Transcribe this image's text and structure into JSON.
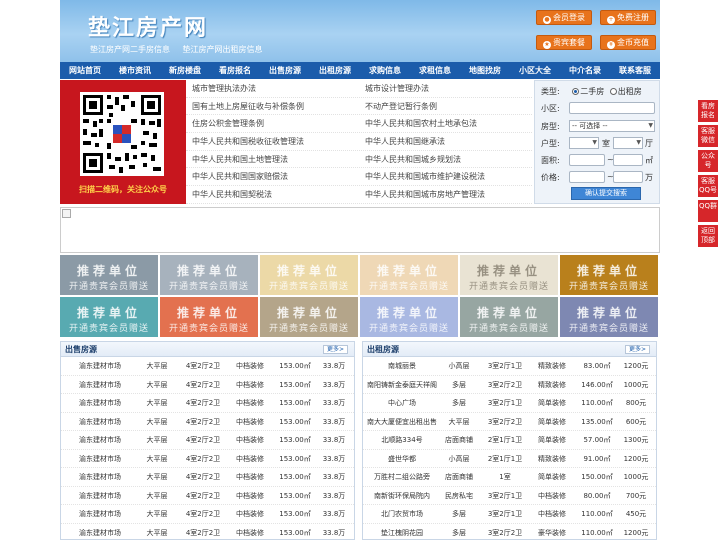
{
  "header": {
    "logo_title": "垫江房产网",
    "subtitles": [
      "垫江房产网二手房信息",
      "垫江房产网出租房信息"
    ],
    "buttons": [
      {
        "label": "会员登录",
        "icon": "user-icon"
      },
      {
        "label": "免费注册",
        "icon": "register-icon"
      },
      {
        "label": "贵宾套餐",
        "icon": "vip-icon"
      },
      {
        "label": "金币充值",
        "icon": "coin-icon"
      }
    ]
  },
  "nav": [
    "网站首页",
    "楼市资讯",
    "新房楼盘",
    "看房报名",
    "出售房源",
    "出租房源",
    "求购信息",
    "求租信息",
    "地图找房",
    "小区大全",
    "中介名录",
    "联系客服"
  ],
  "qr": {
    "caption": "扫描二维码，关注公众号"
  },
  "links": [
    [
      "城市管理执法办法",
      "城市设计管理办法"
    ],
    [
      "国有土地上房屋征收与补偿条例",
      "不动产登记暂行条例"
    ],
    [
      "住房公积金管理条例",
      "中华人民共和国农村土地承包法"
    ],
    [
      "中华人民共和国税收征收管理法",
      "中华人民共和国继承法"
    ],
    [
      "中华人民共和国土地管理法",
      "中华人民共和国城乡规划法"
    ],
    [
      "中华人民共和国国家赔偿法",
      "中华人民共和国城市维护建设税法"
    ],
    [
      "中华人民共和国契税法",
      "中华人民共和国城市房地产管理法"
    ]
  ],
  "search": {
    "type_label": "类型:",
    "radio_sale": "二手房",
    "radio_rent": "出租房",
    "community_label": "小区:",
    "house_type_label": "房型:",
    "house_type_value": "-- 可选择 --",
    "layout_label": "户型:",
    "room_unit": "室",
    "hall_unit": "厅",
    "area_label": "面积:",
    "area_unit": "㎡",
    "price_label": "价格:",
    "price_unit": "万",
    "range_sep": "~",
    "submit": "确认提交搜索"
  },
  "ads": {
    "line1": "推荐单位",
    "line2": "开通贵宾会员赠送",
    "colors": [
      "#8b9aa6",
      "#a7b2bd",
      "#ecd9a7",
      "#efd8b6",
      "#e9e3d3",
      "#b9801c",
      "#58aab1",
      "#e3714f",
      "#b4a58a",
      "#a9b8e2",
      "#97a6a2",
      "#7e88b2"
    ]
  },
  "sale": {
    "title": "出售房源",
    "more": "更多>",
    "rows": [
      [
        "渝东建材市场",
        "大平层",
        "4室2厅2卫",
        "中档装修",
        "153.00㎡",
        "33.8万"
      ],
      [
        "渝东建材市场",
        "大平层",
        "4室2厅2卫",
        "中档装修",
        "153.00㎡",
        "33.8万"
      ],
      [
        "渝东建材市场",
        "大平层",
        "4室2厅2卫",
        "中档装修",
        "153.00㎡",
        "33.8万"
      ],
      [
        "渝东建材市场",
        "大平层",
        "4室2厅2卫",
        "中档装修",
        "153.00㎡",
        "33.8万"
      ],
      [
        "渝东建材市场",
        "大平层",
        "4室2厅2卫",
        "中档装修",
        "153.00㎡",
        "33.8万"
      ],
      [
        "渝东建材市场",
        "大平层",
        "4室2厅2卫",
        "中档装修",
        "153.00㎡",
        "33.8万"
      ],
      [
        "渝东建材市场",
        "大平层",
        "4室2厅2卫",
        "中档装修",
        "153.00㎡",
        "33.8万"
      ],
      [
        "渝东建材市场",
        "大平层",
        "4室2厅2卫",
        "中档装修",
        "153.00㎡",
        "33.8万"
      ],
      [
        "渝东建材市场",
        "大平层",
        "4室2厅2卫",
        "中档装修",
        "153.00㎡",
        "33.8万"
      ],
      [
        "渝东建材市场",
        "大平层",
        "4室2厅2卫",
        "中档装修",
        "153.00㎡",
        "33.8万"
      ]
    ]
  },
  "rent": {
    "title": "出租房源",
    "more": "更多>",
    "rows": [
      [
        "南城丽景",
        "小高层",
        "3室2厅1卫",
        "精致装修",
        "83.00㎡",
        "1200元"
      ],
      [
        "南阳铸新金泰庭天祥阁",
        "多层",
        "3室2厅2卫",
        "精致装修",
        "146.00㎡",
        "1000元"
      ],
      [
        "中心广场",
        "多层",
        "3室2厅1卫",
        "简单装修",
        "110.00㎡",
        "800元"
      ],
      [
        "南大大厦便宜出租出售",
        "大平层",
        "3室2厅2卫",
        "简单装修",
        "135.00㎡",
        "600元"
      ],
      [
        "北顺路334号",
        "店面商铺",
        "2室1厅1卫",
        "简单装修",
        "57.00㎡",
        "1300元"
      ],
      [
        "盛世华都",
        "小高层",
        "2室1厅1卫",
        "精致装修",
        "91.00㎡",
        "1200元"
      ],
      [
        "万胜村二组公路旁",
        "店面商铺",
        "1室",
        "简单装修",
        "150.00㎡",
        "1000元"
      ],
      [
        "南新街环保局院内",
        "民房私宅",
        "3室2厅1卫",
        "中档装修",
        "80.00㎡",
        "700元"
      ],
      [
        "北门农贸市场",
        "多层",
        "3室2厅1卫",
        "中档装修",
        "110.00㎡",
        "450元"
      ],
      [
        "垫江槐阴花园",
        "多层",
        "3室2厅2卫",
        "豪华装修",
        "110.00㎡",
        "1200元"
      ]
    ]
  },
  "side": [
    "看房报名",
    "客服微信",
    "公众号",
    "客服QQ号",
    "QQ群",
    "返回顶部"
  ]
}
